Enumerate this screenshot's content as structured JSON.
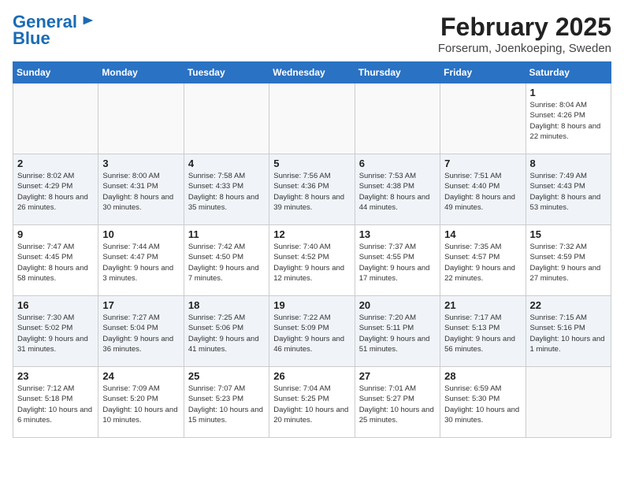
{
  "header": {
    "logo_line1": "General",
    "logo_line2": "Blue",
    "month": "February 2025",
    "location": "Forserum, Joenkoeping, Sweden"
  },
  "weekdays": [
    "Sunday",
    "Monday",
    "Tuesday",
    "Wednesday",
    "Thursday",
    "Friday",
    "Saturday"
  ],
  "weeks": [
    [
      {
        "day": "",
        "info": ""
      },
      {
        "day": "",
        "info": ""
      },
      {
        "day": "",
        "info": ""
      },
      {
        "day": "",
        "info": ""
      },
      {
        "day": "",
        "info": ""
      },
      {
        "day": "",
        "info": ""
      },
      {
        "day": "1",
        "info": "Sunrise: 8:04 AM\nSunset: 4:26 PM\nDaylight: 8 hours and 22 minutes."
      }
    ],
    [
      {
        "day": "2",
        "info": "Sunrise: 8:02 AM\nSunset: 4:29 PM\nDaylight: 8 hours and 26 minutes."
      },
      {
        "day": "3",
        "info": "Sunrise: 8:00 AM\nSunset: 4:31 PM\nDaylight: 8 hours and 30 minutes."
      },
      {
        "day": "4",
        "info": "Sunrise: 7:58 AM\nSunset: 4:33 PM\nDaylight: 8 hours and 35 minutes."
      },
      {
        "day": "5",
        "info": "Sunrise: 7:56 AM\nSunset: 4:36 PM\nDaylight: 8 hours and 39 minutes."
      },
      {
        "day": "6",
        "info": "Sunrise: 7:53 AM\nSunset: 4:38 PM\nDaylight: 8 hours and 44 minutes."
      },
      {
        "day": "7",
        "info": "Sunrise: 7:51 AM\nSunset: 4:40 PM\nDaylight: 8 hours and 49 minutes."
      },
      {
        "day": "8",
        "info": "Sunrise: 7:49 AM\nSunset: 4:43 PM\nDaylight: 8 hours and 53 minutes."
      }
    ],
    [
      {
        "day": "9",
        "info": "Sunrise: 7:47 AM\nSunset: 4:45 PM\nDaylight: 8 hours and 58 minutes."
      },
      {
        "day": "10",
        "info": "Sunrise: 7:44 AM\nSunset: 4:47 PM\nDaylight: 9 hours and 3 minutes."
      },
      {
        "day": "11",
        "info": "Sunrise: 7:42 AM\nSunset: 4:50 PM\nDaylight: 9 hours and 7 minutes."
      },
      {
        "day": "12",
        "info": "Sunrise: 7:40 AM\nSunset: 4:52 PM\nDaylight: 9 hours and 12 minutes."
      },
      {
        "day": "13",
        "info": "Sunrise: 7:37 AM\nSunset: 4:55 PM\nDaylight: 9 hours and 17 minutes."
      },
      {
        "day": "14",
        "info": "Sunrise: 7:35 AM\nSunset: 4:57 PM\nDaylight: 9 hours and 22 minutes."
      },
      {
        "day": "15",
        "info": "Sunrise: 7:32 AM\nSunset: 4:59 PM\nDaylight: 9 hours and 27 minutes."
      }
    ],
    [
      {
        "day": "16",
        "info": "Sunrise: 7:30 AM\nSunset: 5:02 PM\nDaylight: 9 hours and 31 minutes."
      },
      {
        "day": "17",
        "info": "Sunrise: 7:27 AM\nSunset: 5:04 PM\nDaylight: 9 hours and 36 minutes."
      },
      {
        "day": "18",
        "info": "Sunrise: 7:25 AM\nSunset: 5:06 PM\nDaylight: 9 hours and 41 minutes."
      },
      {
        "day": "19",
        "info": "Sunrise: 7:22 AM\nSunset: 5:09 PM\nDaylight: 9 hours and 46 minutes."
      },
      {
        "day": "20",
        "info": "Sunrise: 7:20 AM\nSunset: 5:11 PM\nDaylight: 9 hours and 51 minutes."
      },
      {
        "day": "21",
        "info": "Sunrise: 7:17 AM\nSunset: 5:13 PM\nDaylight: 9 hours and 56 minutes."
      },
      {
        "day": "22",
        "info": "Sunrise: 7:15 AM\nSunset: 5:16 PM\nDaylight: 10 hours and 1 minute."
      }
    ],
    [
      {
        "day": "23",
        "info": "Sunrise: 7:12 AM\nSunset: 5:18 PM\nDaylight: 10 hours and 6 minutes."
      },
      {
        "day": "24",
        "info": "Sunrise: 7:09 AM\nSunset: 5:20 PM\nDaylight: 10 hours and 10 minutes."
      },
      {
        "day": "25",
        "info": "Sunrise: 7:07 AM\nSunset: 5:23 PM\nDaylight: 10 hours and 15 minutes."
      },
      {
        "day": "26",
        "info": "Sunrise: 7:04 AM\nSunset: 5:25 PM\nDaylight: 10 hours and 20 minutes."
      },
      {
        "day": "27",
        "info": "Sunrise: 7:01 AM\nSunset: 5:27 PM\nDaylight: 10 hours and 25 minutes."
      },
      {
        "day": "28",
        "info": "Sunrise: 6:59 AM\nSunset: 5:30 PM\nDaylight: 10 hours and 30 minutes."
      },
      {
        "day": "",
        "info": ""
      }
    ]
  ]
}
